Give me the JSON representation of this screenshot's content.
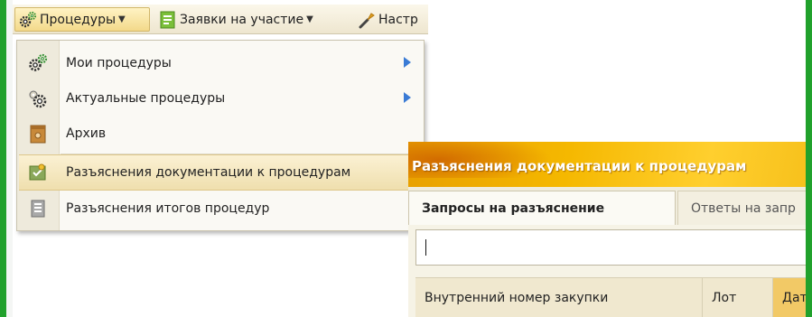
{
  "menubar": {
    "procedures": "Процедуры",
    "applications": "Заявки на участие",
    "settings": "Настр"
  },
  "dropdown": {
    "items": [
      {
        "label": "Мои процедуры",
        "icon": "gears-icon",
        "submenu": true
      },
      {
        "label": "Актуальные процедуры",
        "icon": "gear-check-icon",
        "submenu": true
      },
      {
        "label": "Архив",
        "icon": "archive-box-icon",
        "submenu": false
      },
      {
        "label": "Разъяснения документации к процедурам",
        "icon": "clarification-doc-icon",
        "submenu": false,
        "highlighted": true
      },
      {
        "label": "Разъяснения итогов процедур",
        "icon": "results-doc-icon",
        "submenu": false
      }
    ]
  },
  "window": {
    "title": "Разъяснения документации к процедурам",
    "tabs": [
      "Запросы на разъяснение",
      "Ответы на запр"
    ],
    "search_value": "",
    "columns": [
      "Внутренний номер закупки",
      "Лот",
      "Дат"
    ]
  },
  "colors": {
    "frame": "#21a12c",
    "title_bar": "#f5b800",
    "highlight": "#efdfae",
    "submenu_arrow": "#3a7bd5"
  }
}
